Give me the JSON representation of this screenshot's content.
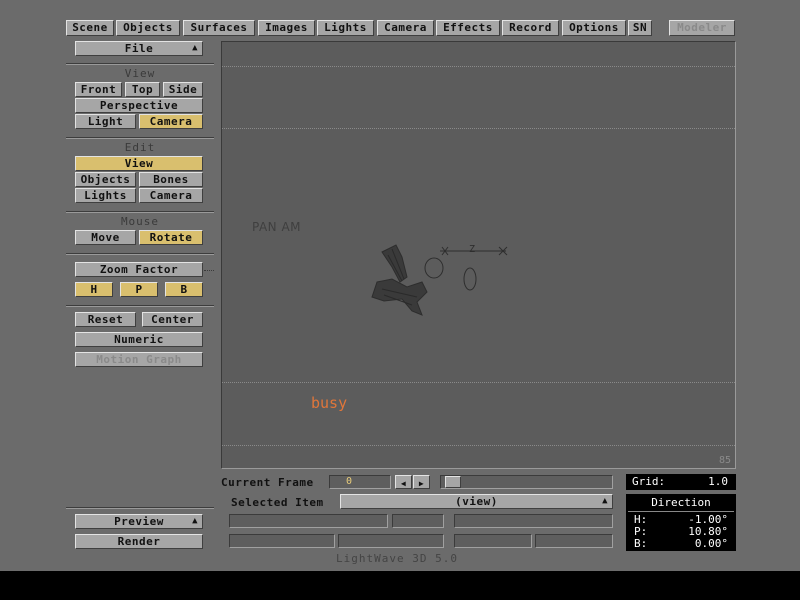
{
  "top_tabs": [
    "Scene",
    "Objects",
    "Surfaces",
    "Images",
    "Lights",
    "Camera",
    "Effects",
    "Record",
    "Options",
    "SN"
  ],
  "modeler_label": "Modeler",
  "file_menu": "File",
  "view_section": {
    "label": "View",
    "front": "Front",
    "top": "Top",
    "side": "Side",
    "perspective": "Perspective",
    "light": "Light",
    "camera": "Camera"
  },
  "edit_section": {
    "label": "Edit",
    "view": "View",
    "objects": "Objects",
    "bones": "Bones",
    "lights": "Lights",
    "camera": "Camera"
  },
  "mouse_section": {
    "label": "Mouse",
    "move": "Move",
    "rotate": "Rotate"
  },
  "zoom_factor": "Zoom Factor",
  "hpb": {
    "h": "H",
    "p": "P",
    "b": "B"
  },
  "reset": "Reset",
  "center": "Center",
  "numeric": "Numeric",
  "motion_graph": "Motion Graph",
  "preview": "Preview",
  "render": "Render",
  "viewport": {
    "object_label": "PAN AM",
    "status": "busy",
    "corner_number": "85",
    "target_letter": "Z"
  },
  "current_frame_label": "Current Frame",
  "current_frame_value": "0",
  "selected_item_label": "Selected Item",
  "selected_item_value": "(view)",
  "grid": {
    "label": "Grid:",
    "value": "1.0"
  },
  "direction": {
    "title": "Direction",
    "h_label": "H:",
    "h_value": "-1.00°",
    "p_label": "P:",
    "p_value": "10.80°",
    "b_label": "B:",
    "b_value": "0.00°"
  },
  "footer_title": "LightWave 3D 5.0",
  "colors": {
    "background": "#6b6b6b",
    "button": "#a6a6a6",
    "active_button": "#d9bf6e",
    "viewport": "#5c5c5c",
    "busy_text": "#e0763a"
  }
}
